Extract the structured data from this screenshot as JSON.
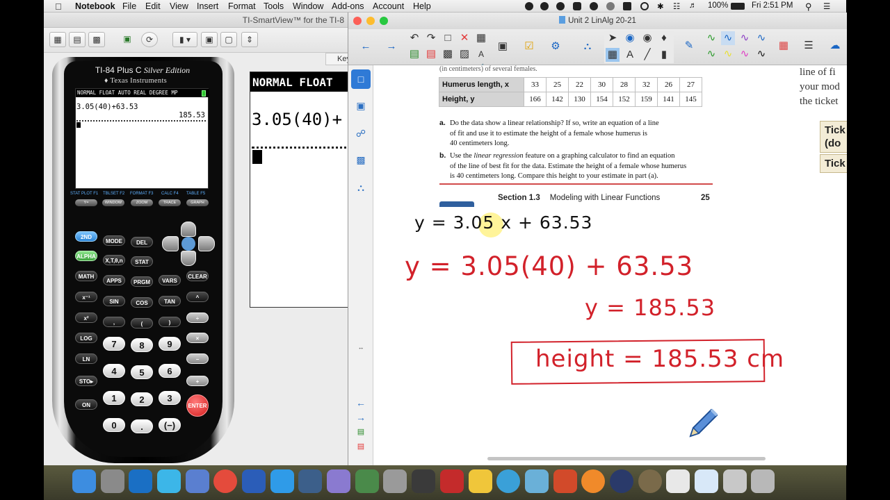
{
  "menubar": {
    "app_name": "Notebook",
    "menus": [
      "File",
      "Edit",
      "View",
      "Insert",
      "Format",
      "Tools",
      "Window",
      "Add-ons",
      "Account",
      "Help"
    ],
    "battery": "100%",
    "clock": "Fri 2:51 PM"
  },
  "smartview": {
    "window_title": "TI-SmartView™ for the TI-8",
    "key_tab": "Key"
  },
  "calculator": {
    "model": "TI-84 Plus C",
    "edition": "Silver Edition",
    "brand": "Texas Instruments",
    "status_line": "NORMAL FLOAT AUTO REAL DEGREE MP",
    "expression": "3.05(40)+63.53",
    "result": "185.53",
    "fkey_labels": [
      "STAT PLOT F1",
      "TBLSET F2",
      "FORMAT F3",
      "CALC F4",
      "TABLE F5"
    ],
    "fkeys": [
      "Y=",
      "WINDOW",
      "ZOOM",
      "TRACE",
      "GRAPH"
    ],
    "keys": {
      "second": "2ND",
      "mode": "MODE",
      "del": "DEL",
      "alpha": "ALPHA",
      "xton": "X,T,θ,n",
      "stat": "STAT",
      "math": "MATH",
      "apps": "APPS",
      "prgm": "PRGM",
      "vars": "VARS",
      "clear": "CLEAR",
      "inv": "x⁻¹",
      "sin": "SIN",
      "cos": "COS",
      "tan": "TAN",
      "pow": "^",
      "sq": "x²",
      "comma": ",",
      "lparen": "(",
      "rparen": ")",
      "div": "÷",
      "log": "LOG",
      "seven": "7",
      "eight": "8",
      "nine": "9",
      "mul": "×",
      "ln": "LN",
      "four": "4",
      "five": "5",
      "six": "6",
      "minus": "−",
      "sto": "STO▸",
      "one": "1",
      "two": "2",
      "three": "3",
      "plus": "+",
      "on": "ON",
      "zero": "0",
      "dot": ".",
      "neg": "(−)",
      "enter": "ENTER"
    }
  },
  "big_display": {
    "status": "NORMAL FLOAT",
    "expression": "3.05(40)+"
  },
  "notebook": {
    "window_title": "Unit 2 LinAlg 20-21",
    "textbook": {
      "cut_header": "(in centimeters) of several females.",
      "table_header_x": "Humerus length, x",
      "table_header_y": "Height, y",
      "x_values": [
        "33",
        "25",
        "22",
        "30",
        "28",
        "32",
        "26",
        "27"
      ],
      "y_values": [
        "166",
        "142",
        "130",
        "154",
        "152",
        "159",
        "141",
        "145"
      ],
      "question_a_label": "a.",
      "question_a": [
        "Do the data show a linear relationship? If so, write an equation of a line",
        "of fit and use it to estimate the height of a female whose humerus is",
        "40 centimeters long."
      ],
      "question_b_label": "b.",
      "question_b_pre": "Use the ",
      "question_b_italic": "linear regression",
      "question_b_post": " feature on a graphing calculator to find an equation",
      "question_b_rest": [
        "of the line of best fit for the data. Estimate the height of a female whose humerus",
        "is 40 centimeters long. Compare this height to your estimate in part (a)."
      ],
      "section_label": "Section 1.3",
      "section_title": "Modeling with Linear Functions",
      "page_number": "25",
      "right_col": [
        "line of fi",
        "your mod",
        "the ticket"
      ],
      "ticket_boxes": [
        "Tick",
        "(do",
        "Tick"
      ]
    },
    "handwriting": {
      "black_equation": "y = 3.05 x + 63.53",
      "red_substitution": "y = 3.05(40) + 63.53",
      "red_result": "y = 185.53",
      "red_answer": "height = 185.53 cm"
    },
    "colors": {
      "ink_black": "#111111",
      "ink_red": "#d2212a",
      "highlight": "#fff078",
      "accent_blue": "#1a66c4"
    }
  },
  "dock": {
    "apps": [
      "finder-icon",
      "launchpad-icon",
      "outlook-icon",
      "notes-icon",
      "big-ideas-math-icon",
      "chrome-icon",
      "word-icon",
      "app-store-icon",
      "quicktime-icon",
      "preview-icon",
      "smartboard-icon",
      "system-preferences-icon",
      "audio-icon",
      "acrobat-icon",
      "onedrive-icon",
      "safari-icon",
      "photos-icon",
      "powerpoint-icon",
      "help-icon",
      "smart-icon",
      "seal-icon",
      "document-icon",
      "spreadsheet-icon",
      "screenshot-icon",
      "trash-icon"
    ]
  }
}
